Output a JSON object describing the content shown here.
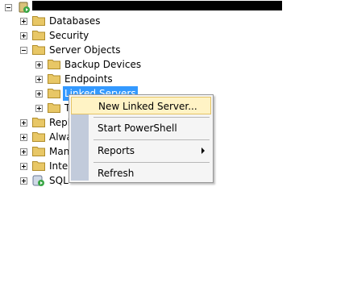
{
  "tree": {
    "items": [
      {
        "label": "Databases"
      },
      {
        "label": "Security"
      },
      {
        "label": "Server Objects"
      },
      {
        "label": "Backup Devices"
      },
      {
        "label": "Endpoints"
      },
      {
        "label": "Linked Servers"
      },
      {
        "label": "T"
      },
      {
        "label": "Repl"
      },
      {
        "label": "Alwa"
      },
      {
        "label": "Man"
      },
      {
        "label": "Integ"
      },
      {
        "label": "SQL"
      }
    ]
  },
  "context_menu": {
    "items": [
      {
        "label": "New Linked Server..."
      },
      {
        "label": "Start PowerShell"
      },
      {
        "label": "Reports"
      },
      {
        "label": "Refresh"
      }
    ]
  },
  "colors": {
    "selection": "#3399ff",
    "menu_highlight": "#fff3c5",
    "menu_gutter": "#c2cbdb",
    "folder": "#e8c766"
  },
  "icons": [
    "server-icon",
    "folder-icon",
    "agent-icon",
    "submenu-arrow-icon"
  ]
}
